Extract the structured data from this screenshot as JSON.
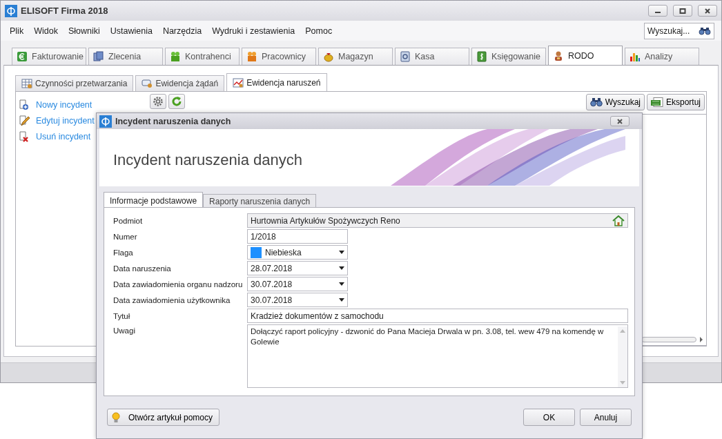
{
  "window": {
    "title": "ELISOFT Firma 2018"
  },
  "menu": [
    "Plik",
    "Widok",
    "Słowniki",
    "Ustawienia",
    "Narzędzia",
    "Wydruki i zestawienia",
    "Pomoc"
  ],
  "search": {
    "placeholder": "Wyszukaj..."
  },
  "module_tabs": [
    {
      "label": "Fakturowanie",
      "selected": false
    },
    {
      "label": "Zlecenia",
      "selected": false
    },
    {
      "label": "Kontrahenci",
      "selected": false
    },
    {
      "label": "Pracownicy",
      "selected": false
    },
    {
      "label": "Magazyn",
      "selected": false
    },
    {
      "label": "Kasa",
      "selected": false
    },
    {
      "label": "Księgowanie",
      "selected": false
    },
    {
      "label": "RODO",
      "selected": true
    },
    {
      "label": "Analizy",
      "selected": false
    }
  ],
  "sub_tabs": [
    {
      "label": "Czynności przetwarzania",
      "selected": false
    },
    {
      "label": "Ewidencja żądań",
      "selected": false
    },
    {
      "label": "Ewidencja naruszeń",
      "selected": true
    }
  ],
  "actions": [
    {
      "kind": "new",
      "label": "Nowy incydent"
    },
    {
      "kind": "edit",
      "label": "Edytuj incydent"
    },
    {
      "kind": "delete",
      "label": "Usuń incydent"
    }
  ],
  "toolbar_buttons": [
    {
      "kind": "search",
      "label": "Wyszukaj"
    },
    {
      "kind": "export",
      "label": "Eksportuj"
    }
  ],
  "dialog": {
    "title": "Incydent naruszenia danych",
    "heading": "Incydent naruszenia danych",
    "tabs": [
      {
        "label": "Informacje podstawowe",
        "selected": true
      },
      {
        "label": "Raporty naruszenia danych",
        "selected": false
      }
    ],
    "fields": [
      {
        "label": "Podmiot",
        "kind": "lookup",
        "value": "Hurtownia Artykułów Spożywczych Reno"
      },
      {
        "label": "Numer",
        "kind": "short_text",
        "value": "1/2018"
      },
      {
        "label": "Flaga",
        "kind": "color_select",
        "value": "Niebieska",
        "color": "#1e90ff"
      },
      {
        "label": "Data naruszenia",
        "kind": "select",
        "value": "28.07.2018"
      },
      {
        "label": "Data zawiadomienia organu nadzoru",
        "kind": "select",
        "value": "30.07.2018"
      },
      {
        "label": "Data zawiadomienia użytkownika",
        "kind": "select",
        "value": "30.07.2018"
      },
      {
        "label": "Tytuł",
        "kind": "text",
        "value": "Kradzież dokumentów z samochodu"
      },
      {
        "label": "Uwagi",
        "kind": "memo",
        "value": "Dołączyć raport policyjny - dzwonić do Pana Macieja Drwala w pn. 3.08, tel. wew 479 na komendę w Golewie"
      }
    ],
    "help_button": "Otwórz artykuł pomocy",
    "buttons": [
      "OK",
      "Anuluj"
    ]
  }
}
